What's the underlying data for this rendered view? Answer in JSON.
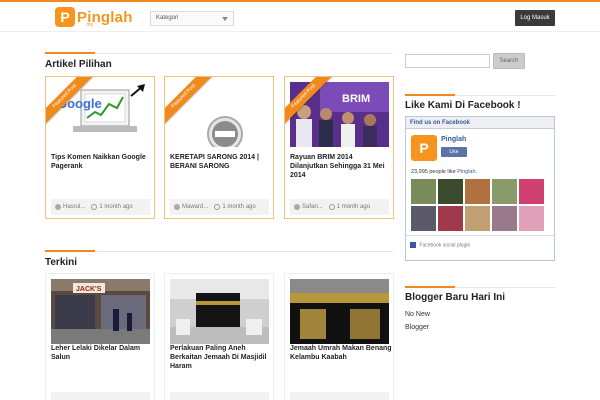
{
  "header": {
    "logo_letter": "P",
    "logo_text": "Pinglah",
    "logo_sub": ".my",
    "category_select": "Kategori",
    "login_button": "Log Masuk"
  },
  "featured": {
    "heading": "Artikel Pilihan",
    "ribbon": "Featured Post",
    "cards": [
      {
        "title": "Tips Komen Naikkan Google Pagerank",
        "author": "Hasrul...",
        "time": "1 month ago",
        "thumb_text": "Google"
      },
      {
        "title": "KERETAPI SARONG 2014 | BERANI SARONG",
        "author": "Maward...",
        "time": "1 month ago",
        "thumb_text": ""
      },
      {
        "title": "Rayuan BRIM 2014 Dilanjutkan Sehingga 31 Mei 2014",
        "author": "Safari...",
        "time": "1 month ago",
        "thumb_text": "BRIM"
      }
    ]
  },
  "latest": {
    "heading": "Terkini",
    "cards": [
      {
        "title": "Leher Lelaki Dikelar Dalam Salun",
        "thumb_text": "JACK'S"
      },
      {
        "title": "Perlakuan Paling Aneh Berkaitan Jemaah Di Masjidil Haram"
      },
      {
        "title": "Jemaah Umrah Makan Benang Kelambu Kaabah"
      }
    ]
  },
  "sidebar": {
    "search_button": "Search",
    "search_placeholder": "",
    "facebook_heading": "Like Kami Di Facebook !",
    "fb_box_head": "Find us on Facebook",
    "fb_page_name": "Pinglah",
    "fb_like": "Like",
    "fb_count_text": "23,995 people like",
    "fb_count_page": "Pinglah.",
    "fb_plugin": "Facebook social plugin",
    "blogger_heading": "Blogger Baru Hari Ini",
    "blogger_items": [
      "No New",
      "Blogger"
    ]
  },
  "colors": {
    "accent": "#f08a1c",
    "facebook": "#3b5998"
  }
}
